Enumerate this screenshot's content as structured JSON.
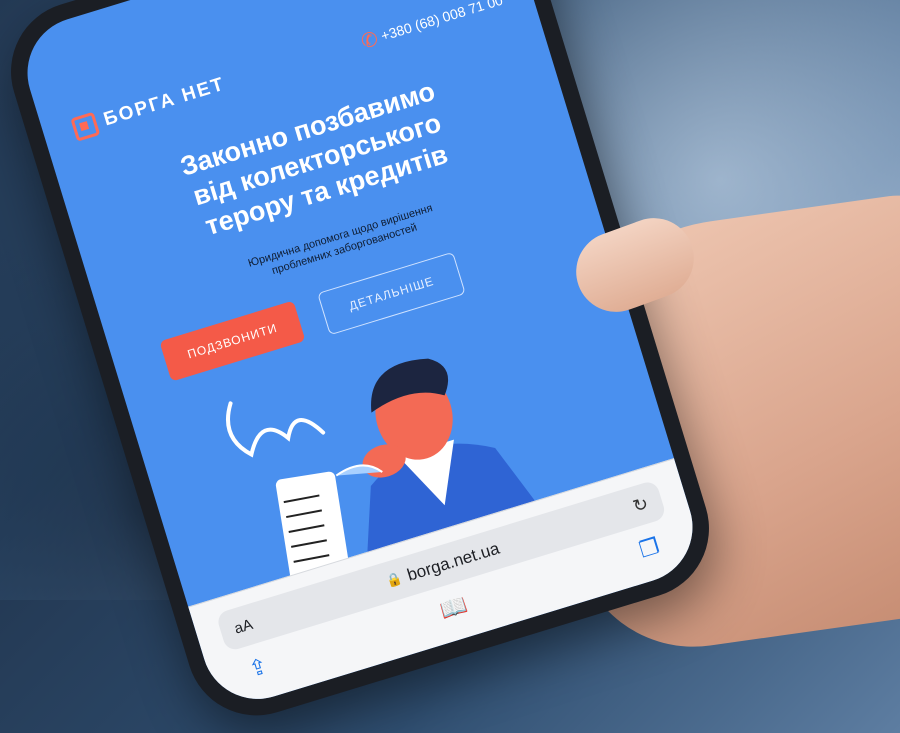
{
  "site": {
    "brand": "БОРГА НЕТ",
    "phone": "+380 (68) 008 71 00",
    "title_lines": [
      "Законно позбавимо",
      "від колекторського",
      "терору та кредитів"
    ],
    "subtitle_lines": [
      "Юридична допомога щодо вирішення",
      "проблемних заборгованостей"
    ],
    "call_button": "ПОДЗВОНИТИ",
    "more_button": "ДЕТАЛЬНІШЕ"
  },
  "browser": {
    "text_size_label": "aA",
    "url": "borga.net.ua"
  },
  "icons": {
    "phone": "phone-icon",
    "lock": "lock-icon",
    "reload": "reload-icon",
    "share": "share-icon",
    "bookmarks": "book-icon",
    "tabs": "tabs-icon"
  },
  "colors": {
    "screen_bg": "#4a90ef",
    "accent": "#f45a48",
    "toolbar_icon": "#1a73e8"
  }
}
